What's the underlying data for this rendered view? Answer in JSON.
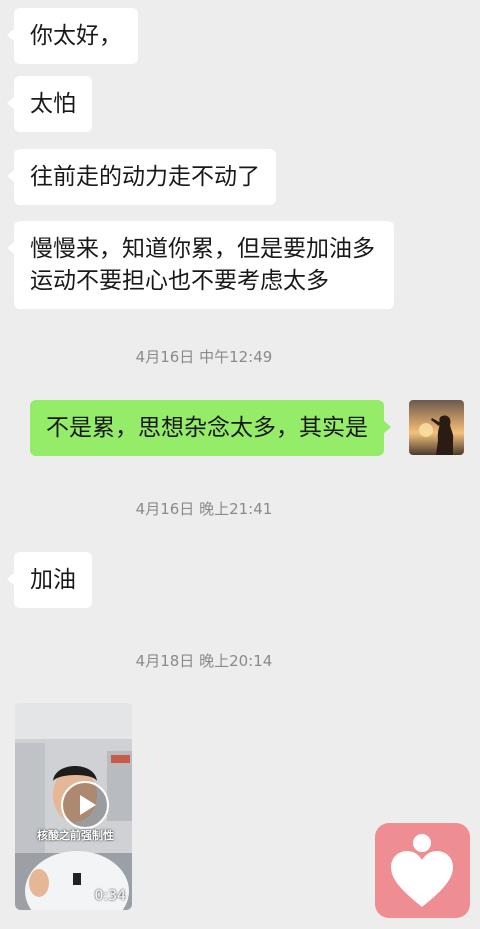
{
  "messages": [
    {
      "side": "left",
      "text": "你太好，"
    },
    {
      "side": "left",
      "text": "太怕"
    },
    {
      "side": "left",
      "text": "往前走的动力走不动了"
    },
    {
      "side": "left",
      "lines": [
        "慢慢来，知道你累，但是要加油多",
        "运动不要担心也不要考虑太多"
      ]
    },
    {
      "side": "timestamp",
      "text": "4月16日 中午12:49"
    },
    {
      "side": "right",
      "text": "不是累，思想杂念太多，其实是"
    },
    {
      "side": "timestamp",
      "text": "4月16日 晚上21:41"
    },
    {
      "side": "left",
      "text": "加油"
    },
    {
      "side": "timestamp",
      "text": "4月18日 晚上20:14"
    }
  ],
  "video": {
    "overlay_text": "核酸之前强制性",
    "duration": "0:34"
  },
  "colors": {
    "background": "#ededed",
    "incoming_bubble": "#ffffff",
    "outgoing_bubble": "#95ec69",
    "heart_button": "#ee8e93"
  }
}
